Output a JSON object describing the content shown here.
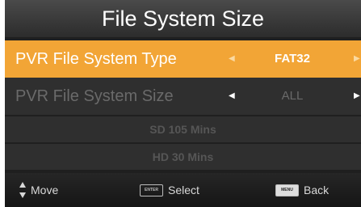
{
  "title": "File System Size",
  "rows": [
    {
      "label": "PVR File System Type",
      "value": "FAT32"
    },
    {
      "label": "PVR File System Size",
      "value": "ALL"
    }
  ],
  "info": [
    "SD 105 Mins",
    "HD 30 Mins"
  ],
  "footer": {
    "move": "Move",
    "select": "Select",
    "select_key": "ENTER",
    "back": "Back",
    "back_key": "MENU"
  }
}
